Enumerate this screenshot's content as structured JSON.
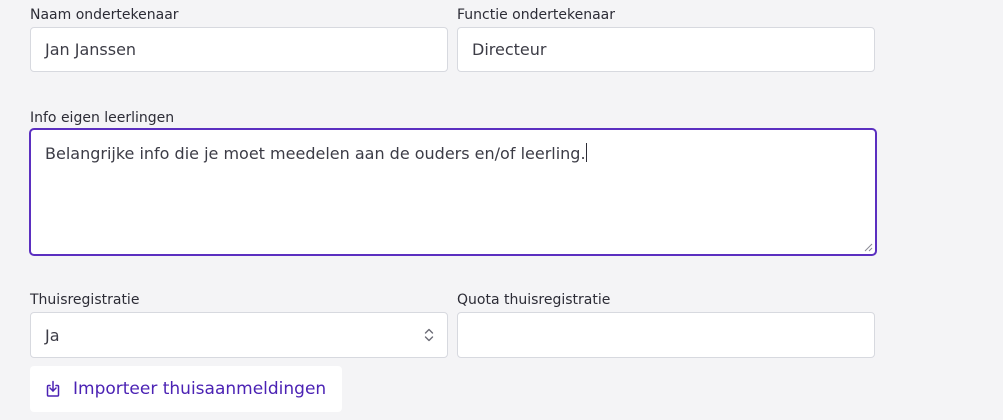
{
  "fields": {
    "signer_name": {
      "label": "Naam ondertekenaar",
      "value": "Jan Janssen"
    },
    "signer_function": {
      "label": "Functie ondertekenaar",
      "value": "Directeur"
    },
    "own_students_info": {
      "label": "Info eigen leerlingen",
      "value": "Belangrijke info die je moet meedelen aan de ouders en/of leerling."
    },
    "home_registration": {
      "label": "Thuisregistratie",
      "value": "Ja"
    },
    "home_registration_quota": {
      "label": "Quota thuisregistratie",
      "value": ""
    }
  },
  "actions": {
    "import_label": "Importeer thuisaanmeldingen"
  },
  "icons": {
    "select": "chevron-up-down-icon",
    "import": "import-download-icon",
    "resize": "resize-grip-icon"
  },
  "colors": {
    "accent": "#5b2fc0",
    "link": "#4b22b4",
    "background": "#f4f4f6",
    "border": "#d7d9df"
  }
}
